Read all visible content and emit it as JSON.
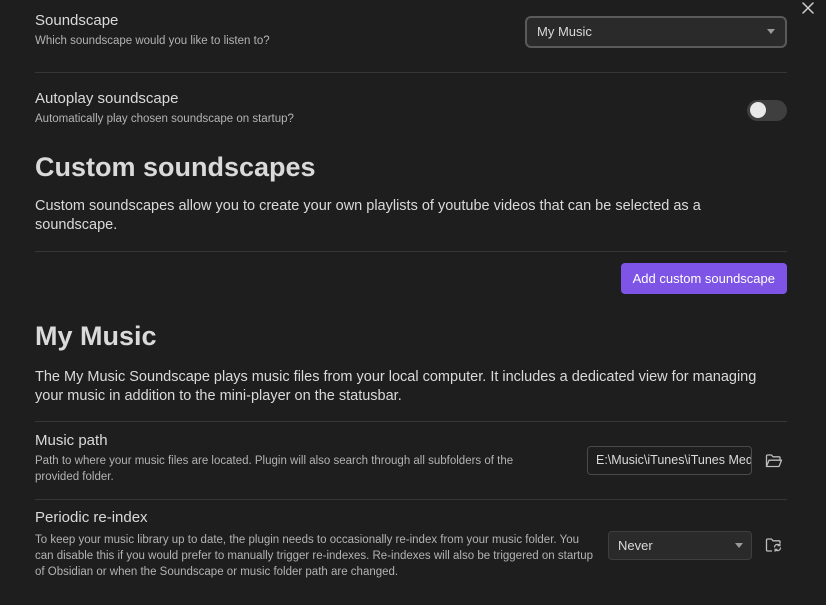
{
  "soundscape": {
    "name": "Soundscape",
    "desc": "Which soundscape would you like to listen to?",
    "selected": "My Music"
  },
  "autoplay": {
    "name": "Autoplay soundscape",
    "desc": "Automatically play chosen soundscape on startup?",
    "enabled": false
  },
  "custom": {
    "heading": "Custom soundscapes",
    "desc": "Custom soundscapes allow you to create your own playlists of youtube videos that can be selected as a soundscape.",
    "add_button": "Add custom soundscape"
  },
  "my_music": {
    "heading": "My Music",
    "desc": "The My Music Soundscape plays music files from your local computer. It includes a dedicated view for managing your music in addition to the mini-player on the statusbar."
  },
  "music_path": {
    "name": "Music path",
    "desc": "Path to where your music files are located. Plugin will also search through all subfolders of the provided folder.",
    "value": "E:\\Music\\iTunes\\iTunes Media\\Music"
  },
  "reindex": {
    "name": "Periodic re-index",
    "desc": "To keep your music library up to date, the plugin needs to occasionally re-index from your music folder. You can disable this if you would prefer to manually trigger re-indexes. Re-indexes will also be triggered on startup of Obsidian or when the Soundscape or music folder path are changed.",
    "selected": "Never"
  },
  "icons": {
    "close": "close-icon",
    "folder": "folder-open-icon",
    "reindex": "folder-sync-icon"
  },
  "colors": {
    "background": "#1e1e1e",
    "accent": "#7e54e6",
    "text": "#dadada",
    "muted": "#b3b3b3"
  }
}
